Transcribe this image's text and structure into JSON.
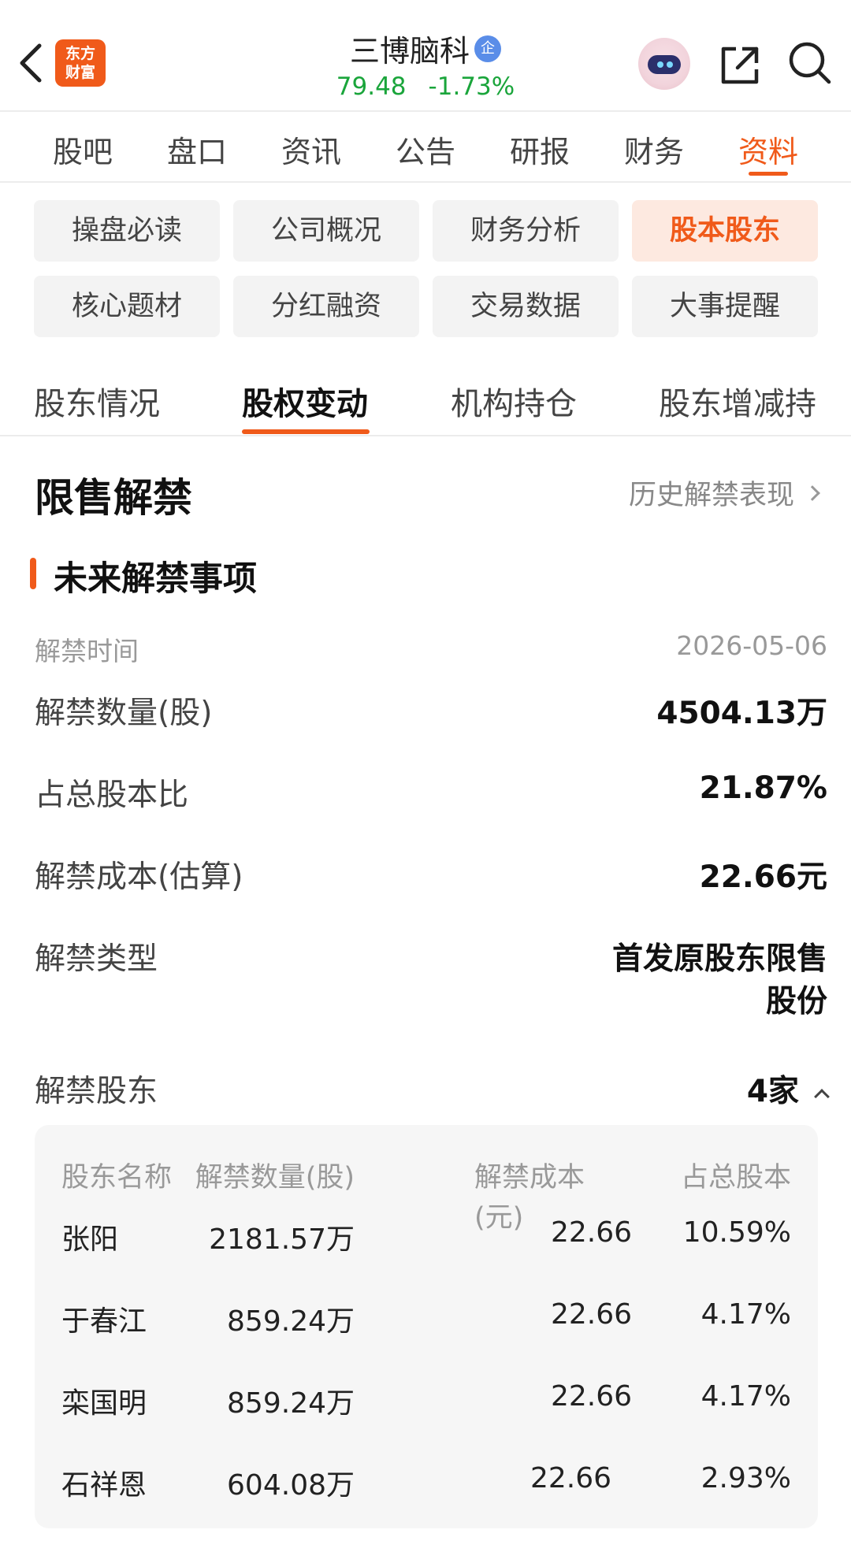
{
  "header": {
    "logo_text": "东方财富",
    "stock_name": "三博脑科",
    "verified_badge": "企",
    "price": "79.48",
    "change_pct": "-1.73%",
    "price_color": "#1aa53b"
  },
  "icons": {
    "back": "back-arrow-icon",
    "avatar": "ai-assistant-avatar",
    "share": "share-icon",
    "search": "search-icon"
  },
  "main_tabs": [
    "股吧",
    "盘口",
    "资讯",
    "公告",
    "研报",
    "财务",
    "资料"
  ],
  "main_tab_active": "资料",
  "sub_buttons": [
    {
      "label": "操盘必读"
    },
    {
      "label": "公司概况"
    },
    {
      "label": "财务分析"
    },
    {
      "label": "股本股东"
    },
    {
      "label": "核心题材"
    },
    {
      "label": "分红融资"
    },
    {
      "label": "交易数据"
    },
    {
      "label": "大事提醒"
    }
  ],
  "sub_button_active": "股本股东",
  "secondary_tabs": [
    "股东情况",
    "股权变动",
    "机构持仓",
    "股东增减持"
  ],
  "secondary_tab_active": "股权变动",
  "section": {
    "title": "限售解禁",
    "history_link": "历史解禁表现",
    "subsection_title": "未来解禁事项"
  },
  "unlock": {
    "time_label": "解禁时间",
    "time_value": "2026-05-06",
    "quantity_label": "解禁数量(股)",
    "quantity_value": "4504.13万",
    "ratio_label": "占总股本比",
    "ratio_value": "21.87%",
    "cost_label": "解禁成本(估算)",
    "cost_value": "22.66元",
    "type_label": "解禁类型",
    "type_value_line1": "首发原股东限售",
    "type_value_line2": "股份",
    "holders_label": "解禁股东",
    "holders_count": "4家"
  },
  "holders_table": {
    "headers": [
      "股东名称",
      "解禁数量(股)",
      "解禁成本(元)",
      "占总股本"
    ],
    "rows": [
      [
        "张阳",
        "2181.57万",
        "22.66",
        "10.59%"
      ],
      [
        "于春江",
        "859.24万",
        "22.66",
        "4.17%"
      ],
      [
        "栾国明",
        "859.24万",
        "22.66",
        "4.17%"
      ],
      [
        "石祥恩",
        "604.08万",
        "22.66",
        "2.93%"
      ]
    ]
  },
  "colors": {
    "accent": "#f05a1a",
    "down": "#1aa53b"
  }
}
